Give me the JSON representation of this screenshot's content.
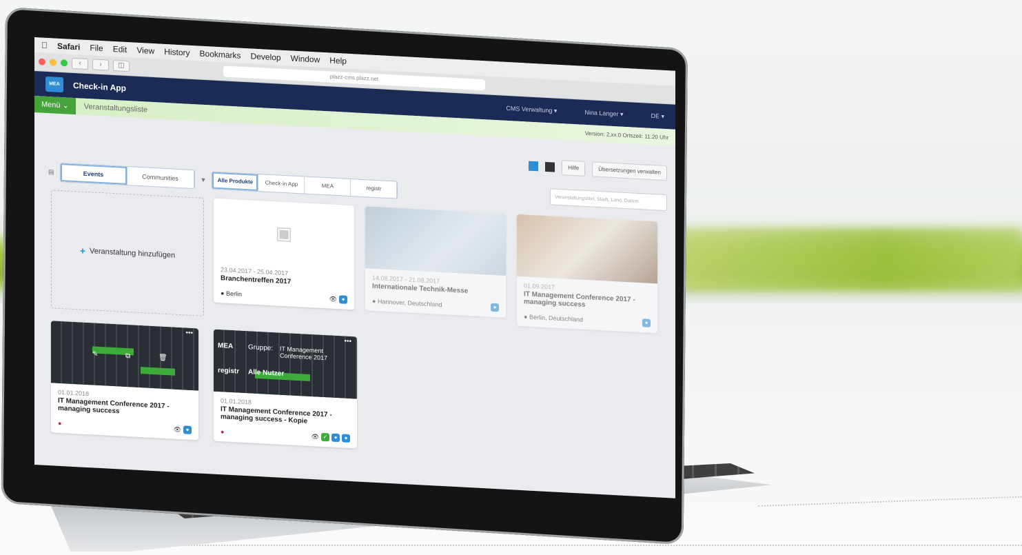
{
  "mac_menu": {
    "apple": "",
    "items": [
      "Safari",
      "File",
      "Edit",
      "View",
      "History",
      "Bookmarks",
      "Develop",
      "Window",
      "Help"
    ]
  },
  "browser": {
    "url": "plazz-cms.plazz.net"
  },
  "app": {
    "title": "Check-in App",
    "logo_text": "MEA",
    "right_menu": [
      "CMS Verwaltung ▾",
      "Nina Langer ▾",
      "DE ▾"
    ]
  },
  "breadcrumb": {
    "menu": "Menü ⌄",
    "current": "Veranstaltungsliste",
    "version": "Version: 2.xx.0 Ortszeit: 11:20 Uhr"
  },
  "toolbar": {
    "help": "Hilfe",
    "translations": "Übersetzungen verwalten"
  },
  "filters": {
    "tabs": [
      "Events",
      "Communities"
    ],
    "products": [
      "Alle Produkte",
      "Check-in App",
      "MEA",
      "registr"
    ],
    "search_placeholder": "Veranstaltungstitel, Stadt, Land, Datum"
  },
  "add_event": {
    "label": "Veranstaltung hinzufügen"
  },
  "events": [
    {
      "date": "23.04.2017 - 25.04.2017",
      "title": "Branchentreffen 2017",
      "location": "Berlin"
    },
    {
      "date": "14.08.2017 - 21.08.2017",
      "title": "Internationale Technik-Messe",
      "location": "Hannover, Deutschland"
    },
    {
      "date": "01.09.2017",
      "title": "IT Management Conference 2017 - managing success",
      "location": "Berlin, Deutschland"
    },
    {
      "date": "01.01.2018",
      "title": "IT Management Conference 2017 - managing success",
      "location": ""
    },
    {
      "date": "01.01.2018",
      "title": "IT Management Conference 2017 - managing success - Kopie",
      "location": "",
      "overlay": {
        "product1": "MEA",
        "group_label": "Gruppe:",
        "group_value": "IT Management Conference 2017",
        "product2": "registr",
        "users": "Alle Nutzer"
      }
    }
  ],
  "card_menu": "•••"
}
